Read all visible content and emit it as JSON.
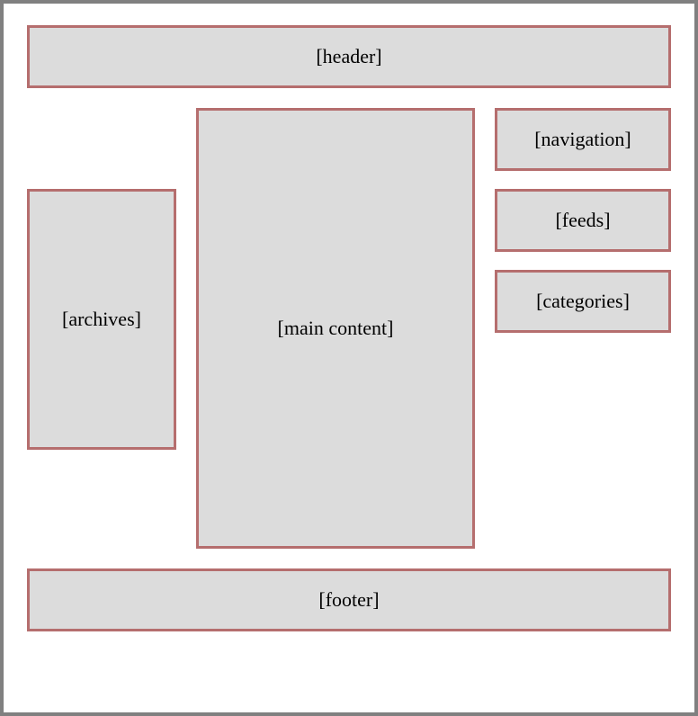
{
  "layout": {
    "header": "[header]",
    "main_content": "[main content]",
    "archives": "[archives]",
    "navigation": "[navigation]",
    "feeds": "[feeds]",
    "categories": "[categories]",
    "footer": "[footer]"
  }
}
